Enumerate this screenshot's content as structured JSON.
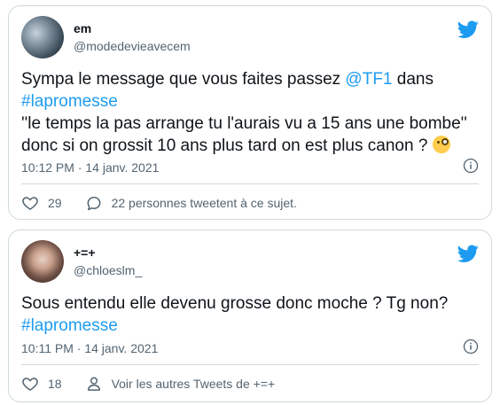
{
  "tweets": [
    {
      "name": "em",
      "handle": "@modedevieavecem",
      "text_before_mention": "Sympa le message que vous faites passez ",
      "mention": "@TF1",
      "text_after_mention": " dans",
      "hashtag": "#lapromesse",
      "line3": "''le temps la pas arrange tu l'aurais vu a 15 ans une bombe''",
      "line4": "donc si on grossit 10 ans plus tard on est plus canon ? ",
      "timestamp": "10:12 PM · 14 janv. 2021",
      "likes": "29",
      "reply_text": "22 personnes tweetent à ce sujet."
    },
    {
      "name": "+=+",
      "handle": "@chloeslm_",
      "text": "Sous entendu elle devenu grosse donc moche ? Tg non?",
      "hashtag": "#lapromesse",
      "timestamp": "10:11 PM · 14 janv. 2021",
      "likes": "18",
      "profile_text": "Voir les autres Tweets de +=+"
    }
  ],
  "colors": {
    "accent": "#1d9bf0",
    "muted": "#536471",
    "border": "#cfd9de"
  },
  "icons": [
    "twitter-bird-icon",
    "info-icon",
    "heart-icon",
    "speech-bubble-icon",
    "person-icon",
    "emoji-monocle-icon"
  ]
}
